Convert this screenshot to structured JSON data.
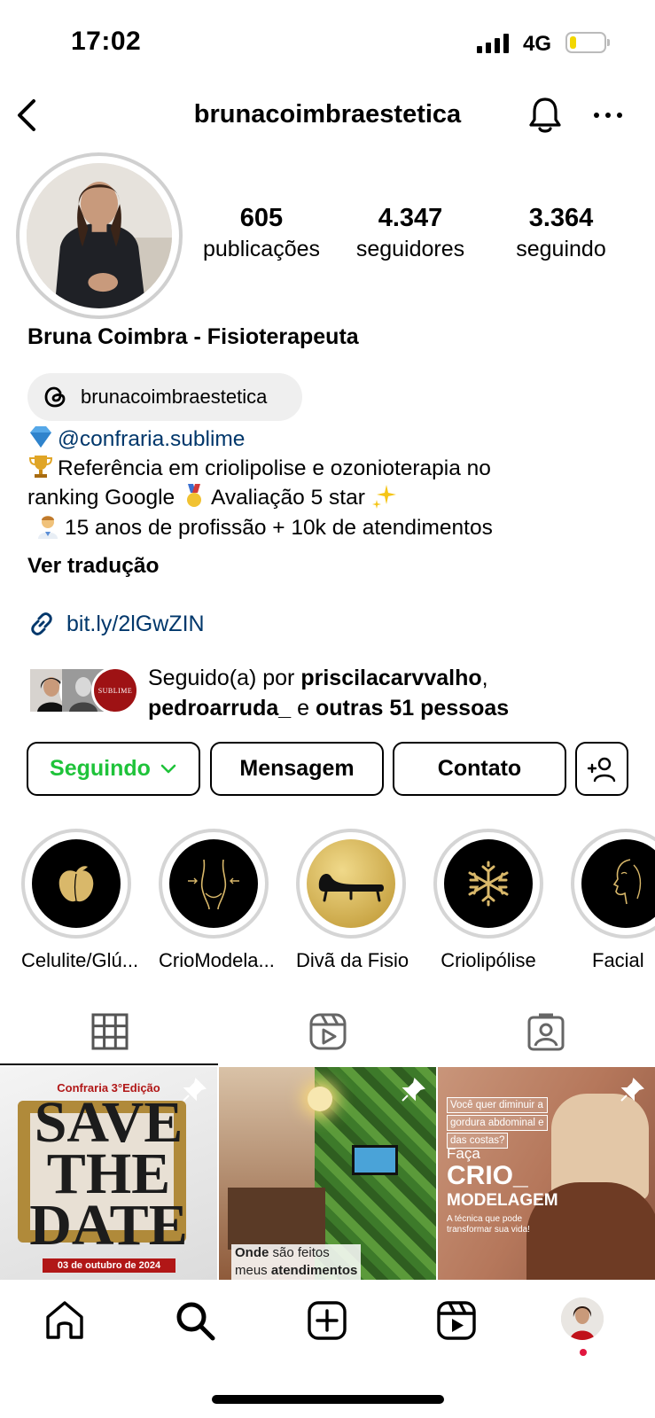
{
  "status_bar": {
    "time": "17:02",
    "network": "4G",
    "battery_level": 0.2
  },
  "header": {
    "username": "brunacoimbraestetica"
  },
  "stats": [
    {
      "value": "605",
      "label": "publicações"
    },
    {
      "value": "4.347",
      "label": "seguidores"
    },
    {
      "value": "3.364",
      "label": "seguindo"
    }
  ],
  "profile": {
    "display_name": "Bruna Coimbra - Fisioterapeuta",
    "threads_handle": "brunacoimbraestetica",
    "bio_mention": "@confraria.sublime",
    "bio_line2": "Referência em criolipolise e ozonioterapia no",
    "bio_line3a": "ranking Google",
    "bio_line3b": "Avaliação 5 star",
    "bio_line4": "15 anos de profissão + 10k de atendimentos",
    "translate": "Ver tradução",
    "link": "bit.ly/2lGwZIN"
  },
  "followed_by": {
    "prefix": "Seguido(a) por",
    "user1": "priscilacarvvalho",
    "sep": ",",
    "user2": "pedroarruda_",
    "and": "e",
    "others": "outras 51 pessoas",
    "avatar3_text": "SUBLIME"
  },
  "actions": {
    "following": "Seguindo",
    "message": "Mensagem",
    "contact": "Contato"
  },
  "highlights": [
    {
      "label": "Celulite/Glú...",
      "icon": "peach-icon"
    },
    {
      "label": "CrioModela...",
      "icon": "body-contour-icon"
    },
    {
      "label": "Divã da Fisio",
      "icon": "chaise-icon"
    },
    {
      "label": "Criolipólise",
      "icon": "snowflake-icon"
    },
    {
      "label": "Facial",
      "icon": "face-profile-icon"
    }
  ],
  "posts": [
    {
      "top": "Confraria 3°Edição",
      "big1": "SAVE",
      "big2": "THE",
      "big3": "DATE",
      "date": "03 de outubro de 2024"
    },
    {
      "caption_bold1": "Onde",
      "caption1": " são feitos",
      "caption2": "meus ",
      "caption_bold2": "atendimentos"
    },
    {
      "q1": "Você quer diminuir a",
      "q2": "gordura abdominal e",
      "q3": "das costas?",
      "faca": "Faça",
      "crio": "CRIO_",
      "modelagem": "MODELAGEM",
      "sub1": "A técnica que pode",
      "sub2": "transformar sua vida!"
    }
  ],
  "colors": {
    "following_green": "#1fc33a",
    "link_blue": "#00376b",
    "gold": "#d9b86a",
    "notification_dot": "#e1173f"
  }
}
